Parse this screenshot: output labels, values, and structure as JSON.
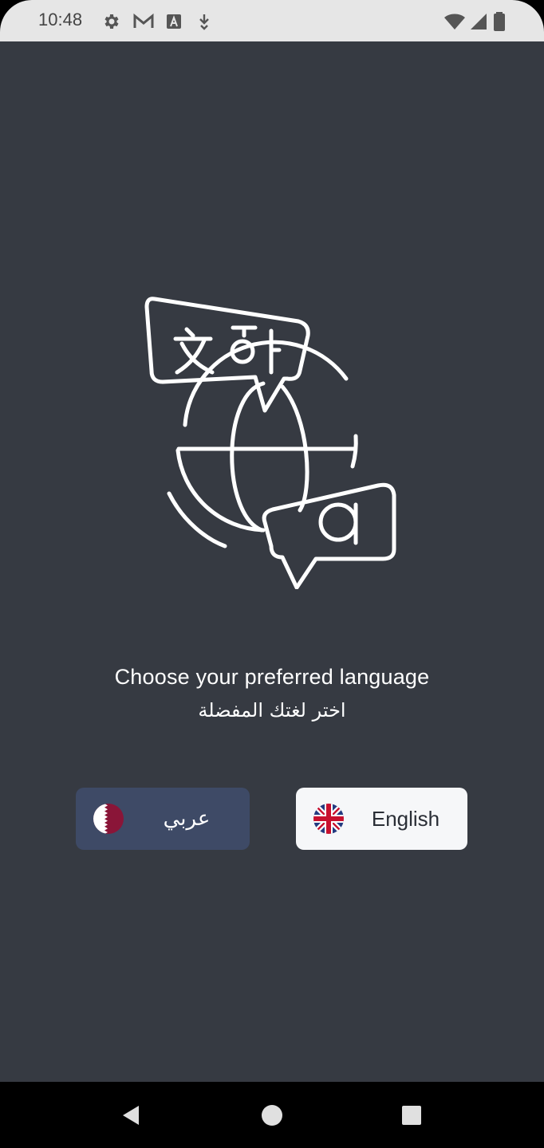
{
  "status_bar": {
    "time": "10:48",
    "left_icons": [
      "gear-icon",
      "gmail-icon",
      "a-box-icon",
      "download-arrow-icon"
    ],
    "right_icons": [
      "wifi-icon",
      "signal-icon",
      "battery-icon"
    ]
  },
  "hero": {
    "icon": "translate-globe-icon"
  },
  "prompt": {
    "english": "Choose your preferred language",
    "arabic": "اختر لغتك المفضلة"
  },
  "buttons": {
    "arabic": {
      "label": "عربي",
      "flag": "qatar-flag-icon"
    },
    "english": {
      "label": "English",
      "flag": "uk-flag-icon"
    }
  },
  "colors": {
    "background": "#363a42",
    "arabic_button": "#3e4a66",
    "english_button": "#f6f7f9",
    "qatar_maroon": "#8a1538"
  },
  "nav_bar": {
    "buttons": [
      "back-icon",
      "home-icon",
      "recents-icon"
    ]
  }
}
